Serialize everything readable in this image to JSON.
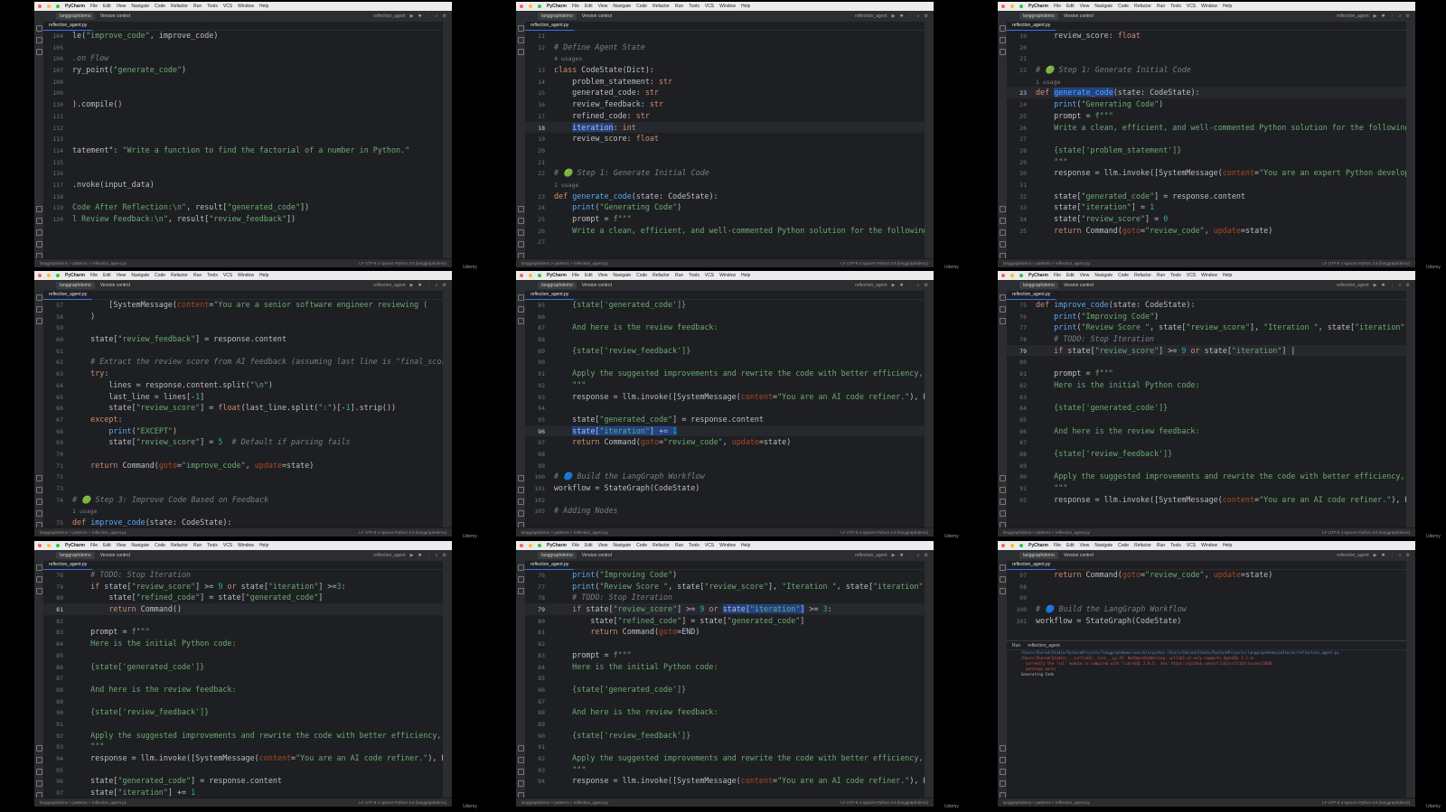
{
  "app": {
    "name": "PyCharm",
    "menu": [
      "File",
      "Edit",
      "View",
      "Navigate",
      "Code",
      "Refactor",
      "Run",
      "Tools",
      "VCS",
      "Window",
      "Help"
    ],
    "project": "langgraphdemo",
    "vcs": "Version control",
    "run_config": "reflection_agent",
    "file_tab": "reflection_agent.py",
    "status_path": "langgraphdemo > patterns > reflection_agent.py",
    "status_right": "LF  UTF-8  4 spaces  Python 3.9 (langgraphdemo)",
    "watermark": "Udemy"
  },
  "panels": [
    {
      "lines": [
        {
          "n": "104",
          "h": "<span>le(</span><span class='s'>\"improve_code\"</span>, improve_code)"
        },
        {
          "n": "105",
          "h": ""
        },
        {
          "n": "106",
          "h": "<span class='c'>.on Flow</span>"
        },
        {
          "n": "107",
          "h": "ry_point(<span class='s'>\"generate_code\"</span>)"
        },
        {
          "n": "108",
          "h": ""
        },
        {
          "n": "109",
          "h": ""
        },
        {
          "n": "110",
          "h": ").compile()"
        },
        {
          "n": "111",
          "h": ""
        },
        {
          "n": "112",
          "h": ""
        },
        {
          "n": "113",
          "h": ""
        },
        {
          "n": "114",
          "h": "tatement\": <span class='s'>\"Write a function to find the factorial of a number in Python.\"</span>"
        },
        {
          "n": "115",
          "h": ""
        },
        {
          "n": "116",
          "h": ""
        },
        {
          "n": "117",
          "h": ".nvoke(input_data)"
        },
        {
          "n": "118",
          "h": ""
        },
        {
          "n": "119",
          "h": "<span class='s'>Code After Reflection:\\n\"</span>, result[<span class='s'>\"generated_code\"</span>])"
        },
        {
          "n": "120",
          "h": "<span class='s'>l Review Feedback:\\n\"</span>, result[<span class='s'>\"review_feedback\"</span>])"
        }
      ]
    },
    {
      "lines": [
        {
          "n": "11",
          "h": ""
        },
        {
          "n": "12",
          "h": "<span class='c'># Define Agent State</span>"
        },
        {
          "n": "",
          "h": "<span class='txt'>4 usages</span>",
          "hint": true
        },
        {
          "n": "13",
          "h": "<span class='k'>class</span> CodeState(Dict):"
        },
        {
          "n": "14",
          "h": "    problem_statement: <span class='k'>str</span>"
        },
        {
          "n": "15",
          "h": "    generated_code: <span class='k'>str</span>"
        },
        {
          "n": "16",
          "h": "    review_feedback: <span class='k'>str</span>"
        },
        {
          "n": "17",
          "h": "    refined_code: <span class='k'>str</span>"
        },
        {
          "n": "18",
          "h": "    <span class='sel'>iteration</span>: <span class='k'>int</span>",
          "hl": true
        },
        {
          "n": "19",
          "h": "    review_score: <span class='k'>float</span>"
        },
        {
          "n": "20",
          "h": ""
        },
        {
          "n": "21",
          "h": ""
        },
        {
          "n": "22",
          "h": "<span class='c'># 🟢 Step 1: Generate Initial Code</span>"
        },
        {
          "n": "",
          "h": "<span class='txt'>1 usage</span>",
          "hint": true
        },
        {
          "n": "23",
          "h": "<span class='k'>def</span> <span class='f'>generate_code</span>(state: CodeState):"
        },
        {
          "n": "24",
          "h": "    <span class='f'>print</span>(<span class='s'>\"Generating Code\"</span>)"
        },
        {
          "n": "25",
          "h": "    prompt = <span class='s'>f\"\"\"</span>"
        },
        {
          "n": "26",
          "h": "    <span class='s'>Write a clean, efficient, and well-commented Python solution for the following p</span>"
        },
        {
          "n": "27",
          "h": ""
        }
      ]
    },
    {
      "lines": [
        {
          "n": "19",
          "h": "    review_score: <span class='k'>float</span>"
        },
        {
          "n": "20",
          "h": ""
        },
        {
          "n": "21",
          "h": ""
        },
        {
          "n": "22",
          "h": "<span class='c'># 🟢 Step 1: Generate Initial Code</span>"
        },
        {
          "n": "",
          "h": "<span class='txt'>1 usage</span>",
          "hint": true
        },
        {
          "n": "23",
          "h": "<span class='k'>def</span> <span class='sel f'>generate_code</span>(state: CodeState):",
          "hl": true
        },
        {
          "n": "24",
          "h": "    <span class='f'>print</span>(<span class='s'>\"Generating Code\"</span>)"
        },
        {
          "n": "25",
          "h": "    prompt = <span class='s'>f\"\"\"</span>"
        },
        {
          "n": "26",
          "h": "    <span class='s'>Write a clean, efficient, and well-commented Python solution for the following pr</span>"
        },
        {
          "n": "27",
          "h": ""
        },
        {
          "n": "28",
          "h": "    <span class='s'>{state['problem_statement']}</span>"
        },
        {
          "n": "29",
          "h": "    <span class='s'>\"\"\"</span>"
        },
        {
          "n": "30",
          "h": "    response = llm.invoke([SystemMessage(<span class='kw'>content</span>=<span class='s'>\"You are an expert Python developer</span>"
        },
        {
          "n": "31",
          "h": ""
        },
        {
          "n": "32",
          "h": "    state[<span class='s'>\"generated_code\"</span>] = response.content"
        },
        {
          "n": "33",
          "h": "    state[<span class='s'>\"iteration\"</span>] = <span class='n'>1</span>"
        },
        {
          "n": "34",
          "h": "    state[<span class='s'>\"review_score\"</span>] = <span class='n'>0</span>"
        },
        {
          "n": "35",
          "h": "    <span class='k'>return</span> Command(<span class='kw'>goto</span>=<span class='s'>\"review_code\"</span>, <span class='kw'>update</span>=state)"
        }
      ]
    },
    {
      "lines": [
        {
          "n": "57",
          "h": "        [SystemMessage(<span class='kw'>content</span>=<span class='s'>\"You are a senior software engineer reviewing (</span>"
        },
        {
          "n": "58",
          "h": "    )"
        },
        {
          "n": "59",
          "h": ""
        },
        {
          "n": "60",
          "h": "    state[<span class='s'>\"review_feedback\"</span>] = response.content"
        },
        {
          "n": "61",
          "h": ""
        },
        {
          "n": "62",
          "h": "    <span class='c'># Extract the review score from AI feedback (assuming last line is \"final_score:</span>"
        },
        {
          "n": "63",
          "h": "    <span class='k'>try</span>:"
        },
        {
          "n": "64",
          "h": "        lines = response.content.split(<span class='s'>\"\\n\"</span>)"
        },
        {
          "n": "65",
          "h": "        last_line = lines[-<span class='n'>1</span>]"
        },
        {
          "n": "66",
          "h": "        state[<span class='s'>\"review_score\"</span>] = <span class='k'>float</span>(last_line.split(<span class='s'>\":\"</span>)[-<span class='n'>1</span>].strip())"
        },
        {
          "n": "67",
          "h": "    <span class='k'>except</span>:"
        },
        {
          "n": "68",
          "h": "        <span class='f'>print</span>(<span class='s'>\"EXCEPT\"</span>)"
        },
        {
          "n": "69",
          "h": "        state[<span class='s'>\"review_score\"</span>] = <span class='n'>5</span>  <span class='c'># Default if parsing fails</span>"
        },
        {
          "n": "70",
          "h": ""
        },
        {
          "n": "71",
          "h": "    <span class='k'>return</span> Command(<span class='kw'>goto</span>=<span class='s'>\"improve_code\"</span>, <span class='kw'>update</span>=state)"
        },
        {
          "n": "72",
          "h": ""
        },
        {
          "n": "73",
          "h": ""
        },
        {
          "n": "74",
          "h": "<span class='c'># 🟢 Step 3: Improve Code Based on Feedback</span>"
        },
        {
          "n": "",
          "h": "<span class='txt'>1 usage</span>",
          "hint": true
        },
        {
          "n": "75",
          "h": "<span class='k'>def</span> <span class='f'>improve_code</span>(state: CodeState):"
        }
      ]
    },
    {
      "lines": [
        {
          "n": "85",
          "h": "    <span class='s'>{state['generated_code']}</span>"
        },
        {
          "n": "86",
          "h": ""
        },
        {
          "n": "87",
          "h": "    <span class='s'>And here is the review feedback:</span>"
        },
        {
          "n": "88",
          "h": ""
        },
        {
          "n": "89",
          "h": "    <span class='s'>{state['review_feedback']}</span>"
        },
        {
          "n": "90",
          "h": ""
        },
        {
          "n": "91",
          "h": "    <span class='s'>Apply the suggested improvements and rewrite the code with better efficiency, rea</span>"
        },
        {
          "n": "92",
          "h": "    <span class='s'>\"\"\"</span>"
        },
        {
          "n": "93",
          "h": "    response = llm.invoke([SystemMessage(<span class='kw'>content</span>=<span class='s'>\"You are an AI code refiner.\"</span>), Huma"
        },
        {
          "n": "94",
          "h": ""
        },
        {
          "n": "95",
          "h": "    state[<span class='s'>\"generated_code\"</span>] = response.content"
        },
        {
          "n": "96",
          "h": "    <span class='sel'>state[<span class='s'>\"iteration\"</span>] += <span class='n'>1</span></span>",
          "hl": true
        },
        {
          "n": "97",
          "h": "    <span class='k'>return</span> Command(<span class='kw'>goto</span>=<span class='s'>\"review_code\"</span>, <span class='kw'>update</span>=state)"
        },
        {
          "n": "98",
          "h": ""
        },
        {
          "n": "99",
          "h": ""
        },
        {
          "n": "100",
          "h": "<span class='c'># 🔵 Build the LangGraph Workflow</span>"
        },
        {
          "n": "101",
          "h": "workflow = StateGraph(CodeState)"
        },
        {
          "n": "102",
          "h": ""
        },
        {
          "n": "103",
          "h": "<span class='c'># Adding Nodes</span>"
        }
      ]
    },
    {
      "lines": [
        {
          "n": "75",
          "h": "<span class='k'>def</span> <span class='f'>improve_code</span>(state: CodeState):"
        },
        {
          "n": "76",
          "h": "    <span class='f'>print</span>(<span class='s'>\"Improving Code\"</span>)"
        },
        {
          "n": "77",
          "h": "    <span class='f'>print</span>(<span class='s'>\"Review Score \"</span>, state[<span class='s'>\"review_score\"</span>], <span class='s'>\"Iteration \"</span>, state[<span class='s'>\"iteration\"</span>])"
        },
        {
          "n": "78",
          "h": "    <span class='c'># TODO: Stop Iteration</span>"
        },
        {
          "n": "79",
          "h": "    <span class='k'>if</span> state[<span class='s'>\"review_score\"</span>] >= <span class='n'>9</span> <span class='k'>or</span> state[<span class='s'>\"iteration\"</span>] |",
          "hl": true
        },
        {
          "n": "80",
          "h": ""
        },
        {
          "n": "81",
          "h": "    prompt = <span class='s'>f\"\"\"</span>"
        },
        {
          "n": "82",
          "h": "    <span class='s'>Here is the initial Python code:</span>"
        },
        {
          "n": "83",
          "h": ""
        },
        {
          "n": "84",
          "h": "    <span class='s'>{state['generated_code']}</span>"
        },
        {
          "n": "85",
          "h": ""
        },
        {
          "n": "86",
          "h": "    <span class='s'>And here is the review feedback:</span>"
        },
        {
          "n": "87",
          "h": ""
        },
        {
          "n": "88",
          "h": "    <span class='s'>{state['review_feedback']}</span>"
        },
        {
          "n": "89",
          "h": ""
        },
        {
          "n": "90",
          "h": "    <span class='s'>Apply the suggested improvements and rewrite the code with better efficiency, rea</span>"
        },
        {
          "n": "91",
          "h": "    <span class='s'>\"\"\"</span>"
        },
        {
          "n": "92",
          "h": "    response = llm.invoke([SystemMessage(<span class='kw'>content</span>=<span class='s'>\"You are an AI code refiner.\"</span>), Huma"
        }
      ]
    },
    {
      "lines": [
        {
          "n": "78",
          "h": "    <span class='c'># TODO: Stop Iteration</span>"
        },
        {
          "n": "79",
          "h": "    <span class='k'>if</span> state[<span class='s'>\"review_score\"</span>] >= <span class='n'>9</span> <span class='k'>or</span> state[<span class='s'>\"iteration\"</span>] >=<span class='n'>3</span>:"
        },
        {
          "n": "80",
          "h": "        state[<span class='s'>\"refined_code\"</span>] = state[<span class='s'>\"generated_code\"</span>]"
        },
        {
          "n": "81",
          "h": "        <span class='k'>return</span> Command()",
          "hl": true
        },
        {
          "n": "82",
          "h": ""
        },
        {
          "n": "83",
          "h": "    prompt = <span class='s'>f\"\"\"</span>"
        },
        {
          "n": "84",
          "h": "    <span class='s'>Here is the initial Python code:</span>"
        },
        {
          "n": "85",
          "h": ""
        },
        {
          "n": "86",
          "h": "    <span class='s'>{state['generated_code']}</span>"
        },
        {
          "n": "87",
          "h": ""
        },
        {
          "n": "88",
          "h": "    <span class='s'>And here is the review feedback:</span>"
        },
        {
          "n": "89",
          "h": ""
        },
        {
          "n": "90",
          "h": "    <span class='s'>{state['review_feedback']}</span>"
        },
        {
          "n": "91",
          "h": ""
        },
        {
          "n": "92",
          "h": "    <span class='s'>Apply the suggested improvements and rewrite the code with better efficiency,</span>"
        },
        {
          "n": "93",
          "h": "    <span class='s'>\"\"\"</span>"
        },
        {
          "n": "94",
          "h": "    response = llm.invoke([SystemMessage(<span class='kw'>content</span>=<span class='s'>\"You are an AI code refiner.\"</span>), Hu"
        },
        {
          "n": "95",
          "h": ""
        },
        {
          "n": "96",
          "h": "    state[<span class='s'>\"generated_code\"</span>] = response.content"
        },
        {
          "n": "97",
          "h": "    state[<span class='s'>\"iteration\"</span>] += <span class='n'>1</span>"
        }
      ]
    },
    {
      "lines": [
        {
          "n": "76",
          "h": "    <span class='f'>print</span>(<span class='s'>\"Improving Code\"</span>)"
        },
        {
          "n": "77",
          "h": "    <span class='f'>print</span>(<span class='s'>\"Review Score \"</span>, state[<span class='s'>\"review_score\"</span>], <span class='s'>\"Iteration \"</span>, state[<span class='s'>\"iteration\"</span>])"
        },
        {
          "n": "78",
          "h": "    <span class='c'># TODO: Stop Iteration</span>"
        },
        {
          "n": "79",
          "h": "    <span class='k'>if</span> state[<span class='s'>\"review_score\"</span>] >= <span class='n'>9</span> <span class='k'>or</span> <span class='sel'>state[<span class='s'>\"iteration\"</span>]</span> >= <span class='n'>3</span>:",
          "hl": true
        },
        {
          "n": "80",
          "h": "        state[<span class='s'>\"refined_code\"</span>] = state[<span class='s'>\"generated_code\"</span>]"
        },
        {
          "n": "81",
          "h": "        <span class='k'>return</span> Command(<span class='kw'>goto</span>=END)"
        },
        {
          "n": "82",
          "h": ""
        },
        {
          "n": "83",
          "h": "    prompt = <span class='s'>f\"\"\"</span>"
        },
        {
          "n": "84",
          "h": "    <span class='s'>Here is the initial Python code:</span>"
        },
        {
          "n": "85",
          "h": ""
        },
        {
          "n": "86",
          "h": "    <span class='s'>{state['generated_code']}</span>"
        },
        {
          "n": "87",
          "h": ""
        },
        {
          "n": "88",
          "h": "    <span class='s'>And here is the review feedback:</span>"
        },
        {
          "n": "89",
          "h": ""
        },
        {
          "n": "90",
          "h": "    <span class='s'>{state['review_feedback']}</span>"
        },
        {
          "n": "91",
          "h": ""
        },
        {
          "n": "92",
          "h": "    <span class='s'>Apply the suggested improvements and rewrite the code with better efficiency, r</span>"
        },
        {
          "n": "93",
          "h": "    <span class='s'>\"\"\"</span>"
        },
        {
          "n": "94",
          "h": "    response = llm.invoke([SystemMessage(<span class='kw'>content</span>=<span class='s'>\"You are an AI code refiner.\"</span>), Hu"
        }
      ]
    },
    {
      "lines": [
        {
          "n": "97",
          "h": "    <span class='k'>return</span> Command(<span class='kw'>goto</span>=<span class='s'>\"review_code\"</span>, <span class='kw'>update</span>=state)"
        },
        {
          "n": "98",
          "h": ""
        },
        {
          "n": "99",
          "h": ""
        },
        {
          "n": "100",
          "h": "<span class='c'># 🔵 Build the LangGraph Workflow</span>"
        },
        {
          "n": "101",
          "h": "workflow = StateGraph(CodeState)"
        }
      ],
      "run": {
        "tabs": [
          "Run",
          "reflection_agent"
        ],
        "lines": [
          {
            "cls": "path",
            "t": "/Users/Shared/Studio/PycharmProjects/langgraphdemo/venv/bin/python /Users/Shared/Studio/PycharmProjects/langgraphdemo/patterns/reflection_agent.py"
          },
          {
            "cls": "err",
            "t": "/Users/Shared/Studio/.../urllib3/__init__.py:35: NotOpenSSLWarning: urllib3 v2 only supports OpenSSL 1.1.1+"
          },
          {
            "cls": "err",
            "t": "  currently the 'ssl' module is compiled with 'LibreSSL 2.8.3'. See: https://github.com/urllib3/urllib3/issues/3020"
          },
          {
            "cls": "err",
            "t": "  warnings.warn("
          },
          {
            "cls": "plain",
            "t": "Generating Code"
          }
        ]
      }
    }
  ]
}
